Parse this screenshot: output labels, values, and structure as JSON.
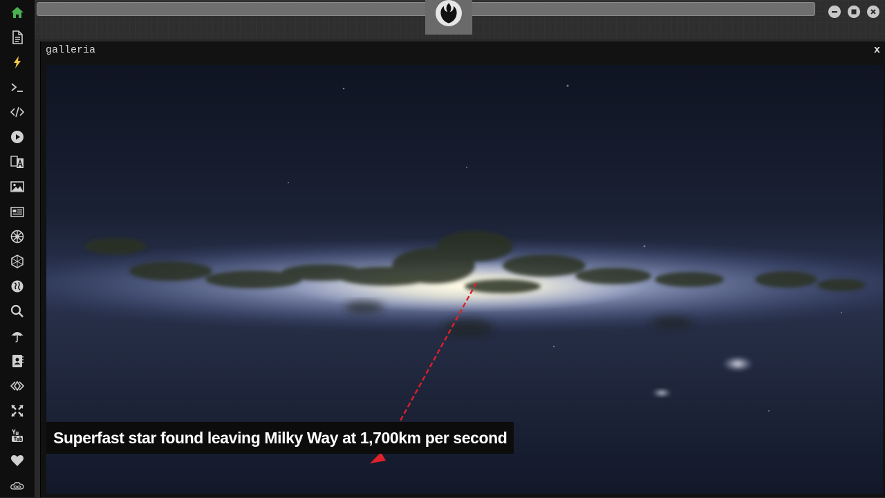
{
  "sidebar": {
    "items": [
      {
        "icon": "home-icon",
        "color": "#4caf50"
      },
      {
        "icon": "document-icon",
        "color": "#d0d0d0"
      },
      {
        "icon": "lightning-icon",
        "color": "#f2c744"
      },
      {
        "icon": "terminal-icon",
        "color": "#d0d0d0"
      },
      {
        "icon": "code-icon",
        "color": "#d0d0d0"
      },
      {
        "icon": "play-icon",
        "color": "#d0d0d0"
      },
      {
        "icon": "translate-icon",
        "color": "#d0d0d0"
      },
      {
        "icon": "image-icon",
        "color": "#d0d0d0"
      },
      {
        "icon": "newspaper-icon",
        "color": "#d0d0d0"
      },
      {
        "icon": "galactic-empire-icon",
        "color": "#d0d0d0"
      },
      {
        "icon": "hexagon-icon",
        "color": "#d0d0d0"
      },
      {
        "icon": "globe-icon",
        "color": "#d0d0d0"
      },
      {
        "icon": "search-icon",
        "color": "#d0d0d0"
      },
      {
        "icon": "umbrella-icon",
        "color": "#d0d0d0"
      },
      {
        "icon": "contact-book-icon",
        "color": "#d0d0d0"
      },
      {
        "icon": "code-fork-icon",
        "color": "#d0d0d0"
      },
      {
        "icon": "expand-icon",
        "color": "#d0d0d0"
      },
      {
        "icon": "youtube-icon",
        "color": "#d0d0d0"
      },
      {
        "icon": "heart-icon",
        "color": "#d0d0d0"
      },
      {
        "icon": "infinity-cloud-icon",
        "color": "#d0d0d0"
      }
    ]
  },
  "topbar": {
    "address": "",
    "logo_icon": "rebel-alliance-icon",
    "window_controls": [
      "minimize",
      "maximize",
      "close"
    ]
  },
  "panel": {
    "title": "galleria",
    "close_label": "x",
    "image_subject": "milky-way-panorama",
    "caption": "Superfast star found leaving Milky Way at 1,700km per second"
  },
  "colors": {
    "accent_home": "#4caf50",
    "accent_lightning": "#f2c744",
    "trajectory": "#e0202a"
  }
}
